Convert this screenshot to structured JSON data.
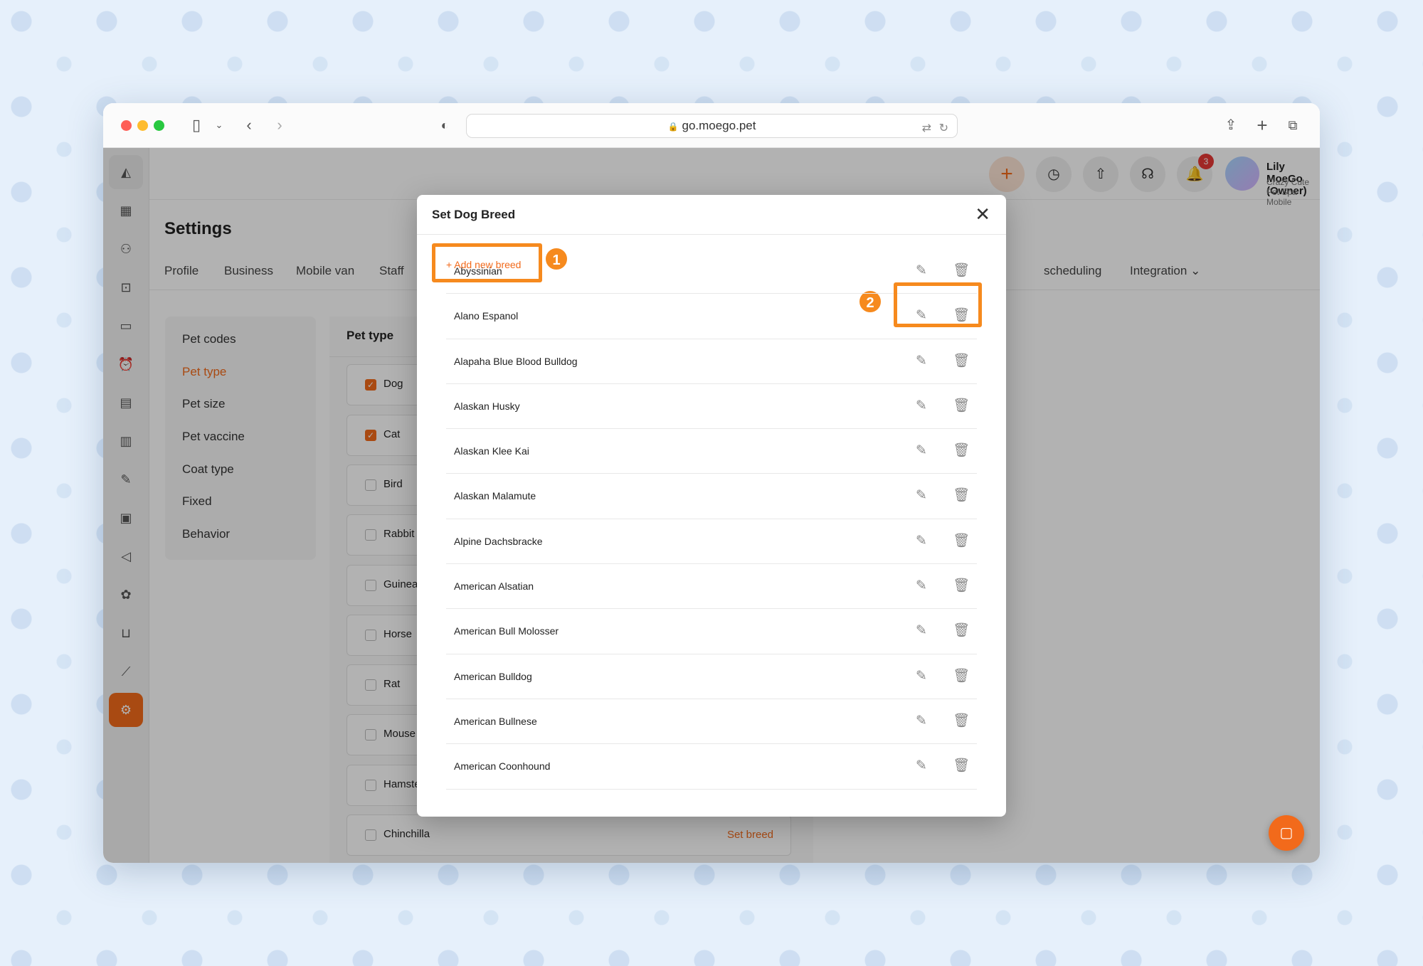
{
  "browser": {
    "url": "go.moego.pet"
  },
  "topbar": {
    "notification_count": "3",
    "user_name": "Lily MoeGo (Owner)",
    "business_name": "Crazy Cute Pet Spa Mobile"
  },
  "settings": {
    "title": "Settings",
    "tabs": [
      "Profile",
      "Business",
      "Mobile van",
      "Staff",
      "scheduling",
      "Integration"
    ],
    "submenu": [
      "Pet codes",
      "Pet type",
      "Pet size",
      "Pet vaccine",
      "Coat type",
      "Fixed",
      "Behavior"
    ],
    "active_submenu": "Pet type"
  },
  "pet_type_panel": {
    "title": "Pet type",
    "pets": [
      {
        "label": "Dog",
        "checked": true
      },
      {
        "label": "Cat",
        "checked": true
      },
      {
        "label": "Bird",
        "checked": false
      },
      {
        "label": "Rabbit",
        "checked": false
      },
      {
        "label": "Guinea",
        "checked": false
      },
      {
        "label": "Horse",
        "checked": false
      },
      {
        "label": "Rat",
        "checked": false
      },
      {
        "label": "Mouse",
        "checked": false
      },
      {
        "label": "Hamste",
        "checked": false
      },
      {
        "label": "Chinchilla",
        "checked": false
      }
    ],
    "set_breed_label": "Set breed"
  },
  "modal": {
    "title": "Set Dog Breed",
    "add_button_label": "+ Add new breed",
    "callouts": [
      "1",
      "2"
    ],
    "breeds": [
      "Abyssinian",
      "Alano Espanol",
      "Alapaha Blue Blood Bulldog",
      "Alaskan Husky",
      "Alaskan Klee Kai",
      "Alaskan Malamute",
      "Alpine Dachsbracke",
      "American Alsatian",
      "American Bull Molosser",
      "American Bulldog",
      "American Bullnese",
      "American Coonhound"
    ]
  },
  "icons": {
    "edit": "edit-icon",
    "delete": "trash-icon",
    "close": "close-icon"
  },
  "colors": {
    "accent": "#f26a1b",
    "highlight": "#f68a1e"
  }
}
